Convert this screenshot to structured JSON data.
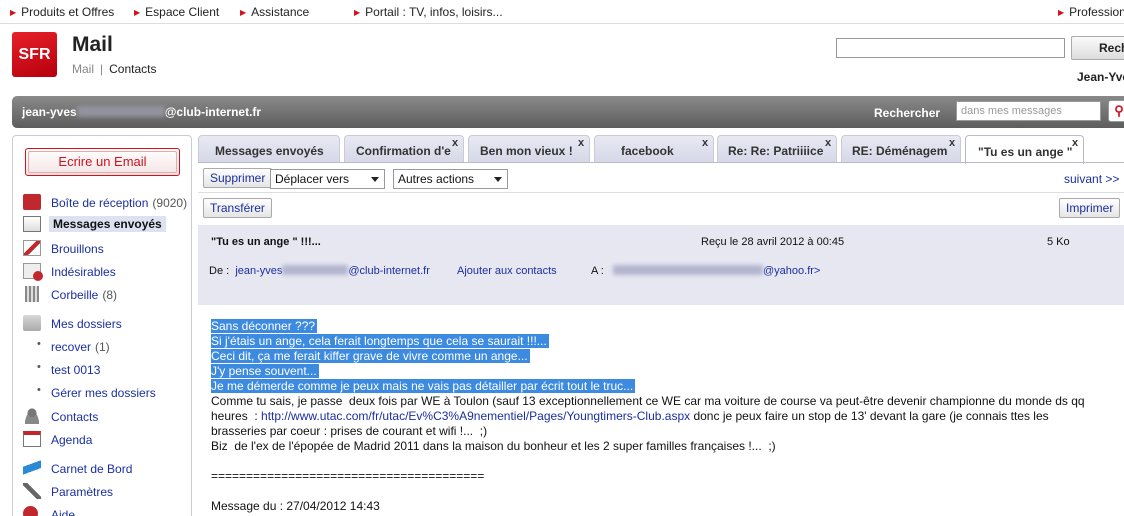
{
  "topnav": {
    "items": [
      "Produits et Offres",
      "Espace Client",
      "Assistance",
      "Portail : TV, infos, loisirs...",
      "Profession"
    ]
  },
  "header": {
    "logo": "SFR",
    "title": "Mail",
    "subnav_mail": "Mail",
    "subnav_sep": "|",
    "subnav_contacts": "Contacts",
    "search_button": "Rech",
    "user": "Jean-Yves"
  },
  "account": {
    "email_prefix": "jean-yves",
    "email_suffix": "@club-internet.fr",
    "search_label": "Rechercher",
    "search_placeholder": "dans mes messages"
  },
  "sidebar": {
    "compose": "Ecrire un Email",
    "folders": [
      {
        "label": "Boîte de réception",
        "count": "(9020)"
      },
      {
        "label": "Messages envoyés",
        "count": ""
      },
      {
        "label": "Brouillons",
        "count": ""
      },
      {
        "label": "Indésirables",
        "count": ""
      },
      {
        "label": "Corbeille",
        "count": "(8)"
      },
      {
        "label": "Mes dossiers",
        "count": ""
      },
      {
        "label": "recover",
        "count": "(1)"
      },
      {
        "label": "test 0013",
        "count": ""
      },
      {
        "label": "Gérer mes dossiers",
        "count": ""
      },
      {
        "label": "Contacts",
        "count": ""
      },
      {
        "label": "Agenda",
        "count": ""
      },
      {
        "label": "Carnet de Bord",
        "count": ""
      },
      {
        "label": "Paramètres",
        "count": ""
      },
      {
        "label": "Aide",
        "count": ""
      }
    ]
  },
  "tabs": [
    {
      "label": "Messages envoyés"
    },
    {
      "label": "Confirmation d'e"
    },
    {
      "label": "Ben mon vieux !"
    },
    {
      "label": "facebook"
    },
    {
      "label": "Re: Re: Patriiiice"
    },
    {
      "label": "RE: Déménagem"
    },
    {
      "label": "\"Tu es un ange \""
    }
  ],
  "toolbar": {
    "delete": "Supprimer",
    "move": "Déplacer vers",
    "actions": "Autres actions",
    "next": "suivant >>",
    "forward": "Transférer",
    "print": "Imprimer"
  },
  "message": {
    "subject": "\"Tu es un ange \" !!!...",
    "received": "Reçu le 28 avril 2012 à 00:45",
    "size": "5 Ko",
    "from_label": "De :",
    "from_prefix": "jean-yves",
    "from_suffix": "@club-internet.fr",
    "add_contacts": "Ajouter aux contacts",
    "to_label": "A :",
    "to_suffix": "@yahoo.fr>",
    "highlighted_lines": [
      "Sans déconner ???",
      "Si j'étais un ange, cela ferait longtemps que cela se saurait !!!...",
      "Ceci dit, ça me ferait kiffer grave de vivre comme un ange...",
      "J'y pense souvent...",
      "Je me démerde comme je peux mais ne vais pas détailler par écrit tout le truc..."
    ],
    "line6": "Comme tu sais, je passe  deux fois par WE à Toulon (sauf 13 exceptionnellement ce WE car ma voiture de course va peut-être devenir championne du monde ds qq",
    "line7_before": "heures  : ",
    "line7_link": "http://www.utac.com/fr/utac/Ev%C3%A9nementiel/Pages/Youngtimers-Club.aspx",
    "line7_after": " donc je peux faire un stop de 13' devant la gare (je connais ttes les",
    "line8": "brasseries par coeur : prises de courant et wifi !...  ;)",
    "line9": "Biz  de l'ex de l'épopée de Madrid 2011 dans la maison du bonheur et les 2 super familles françaises !...  ;)",
    "separator": "=======================================",
    "quoted": "Message du : 27/04/2012 14:43"
  }
}
